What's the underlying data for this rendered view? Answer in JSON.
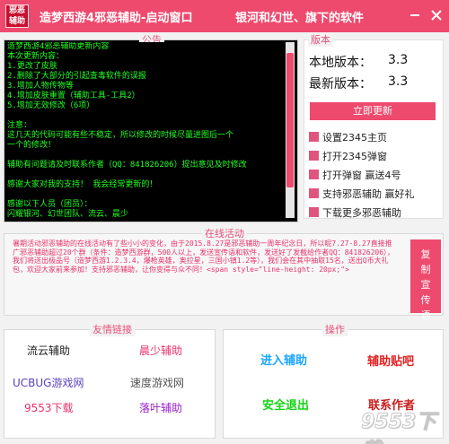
{
  "titlebar": {
    "logo_text": "邪恶辅助",
    "title": "造梦西游4邪恶辅助-启动窗口",
    "subtitle": "银河和幻世、旗下的软件",
    "minimize_icon": "minimize-icon",
    "close_icon": "close-icon"
  },
  "notice": {
    "legend": "公告",
    "lines": [
      "        造梦西游4邪恶辅助更新内容",
      "本次更新内容：",
      "1.更改了皮肤",
      "2.删除了大部分的引起查毒软件的误报",
      "3.增加人物传物等",
      "4.增加皮肤重置（辅助工具-工具2）",
      "5.增加无效修改（6项）",
      "",
      "注意：",
      "  这几天的代码可能有些不稳定，所以修改的时候尽量进图后一个",
      "  一个的修改！",
      "",
      "辅助有问题请及时联系作者（QQ：841826206）提出意见及时修改",
      "",
      "        感谢大家对我的支持！ 我会经常更新的！",
      "",
      "              感谢以下人员（团员）：",
      "          闪耀银河、幻世团队、流云、晨少"
    ]
  },
  "version": {
    "legend": "版本",
    "local_label": "本地版本：",
    "local_value": "3.3",
    "latest_label": "最新版本：",
    "latest_value": "3.3",
    "update_button": "立即更新",
    "links": [
      "设置2345主页",
      "打开2345弹窗",
      "打开弹窗 赢送4号",
      "支持邪恶辅助 赢好礼",
      "下载更多邪恶辅助"
    ]
  },
  "online": {
    "legend": "在线活动",
    "text": "暑期活动邪恶辅助的在线活动有了些小小的变化，由于2015.8.27是邪恶辅助一周年纪念日，所以呢7.27-8.27直接推广邪恶辅助超过20个群（条件：造梦西游群，500人以上，发送宣传语和软件，发送好了发截给作者QQ：841826206），我们将送出极品号（造梦西游1.2.3.4，爆枪英雄，奥拉星，三国小镇1.2等），我们会在其中抽取15名，送出Q币大礼包，欢迎大家前来参加！支持邪恶辅助，让你变得与众不同！<span style=\"line-height: 20px;\"> ",
    "copy_button": "复制宣传语"
  },
  "friends": {
    "legend": "友情链接",
    "items": [
      "流云辅助",
      "晨少辅助",
      "UCBUG游戏网",
      "速度游戏网",
      "9553下载",
      "落叶辅助"
    ],
    "colors": [
      "#222222",
      "#e8326b",
      "#5b3fc2",
      "#555555",
      "#e8326b",
      "#9922cc"
    ]
  },
  "operations": {
    "legend": "操作",
    "enter": "进入辅助",
    "paste": "辅助贴吧",
    "exit": "安全退出",
    "contact": "联系作者",
    "colors": [
      "#1aa6ff",
      "#e02020",
      "#14d414",
      "#c81e1e"
    ]
  },
  "watermark": "9553下载"
}
